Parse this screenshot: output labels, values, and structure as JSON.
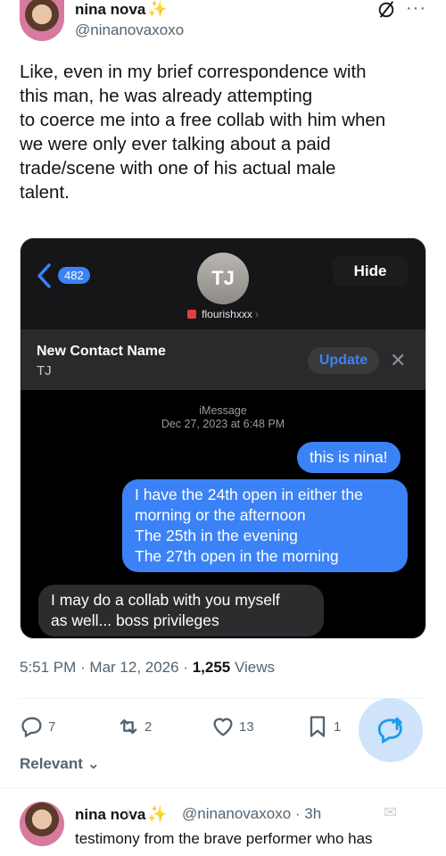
{
  "author": {
    "name": "nina nova",
    "sparkle": "✨",
    "handle": "@ninanovaxoxo"
  },
  "tweet_text": "Like, even in my brief correspondence with\nthis man, he was already attempting\nto coerce me into a free collab with him when\nwe were only ever talking about a paid\ntrade/scene with one of his actual male\ntalent.",
  "screenshot": {
    "back_badge": "482",
    "contact_initials": "TJ",
    "contact_handle": "flourishxxx",
    "hide_label": "Hide",
    "new_contact_title": "New Contact Name",
    "new_contact_sub": "TJ",
    "update_label": "Update",
    "service": "iMessage",
    "timestamp": "Dec 27, 2023 at 6:48 PM",
    "messages": [
      {
        "from": "me",
        "text": "this is nina!"
      },
      {
        "from": "me",
        "text": "I have the 24th open in either the\nmorning or the afternoon\nThe 25th in the evening\nThe 27th open in the morning"
      },
      {
        "from": "them",
        "text": "I may do a collab with you myself\nas well... boss privileges"
      }
    ]
  },
  "meta": {
    "time": "5:51 PM · Mar 12, 2026 · ",
    "views_count": "1,255",
    "views_label": " Views"
  },
  "actions": {
    "replies": "7",
    "reposts": "2",
    "likes": "13",
    "bookmarks": "1"
  },
  "relevant_label": "Relevant",
  "reply_preview": {
    "name": "nina nova",
    "sparkle": "✨",
    "handle": "@ninanovaxoxo · 3h",
    "text": "testimony from the brave performer who has"
  },
  "colors": {
    "accent": "#1d9bf0",
    "imessage_blue": "#3b82f6"
  }
}
